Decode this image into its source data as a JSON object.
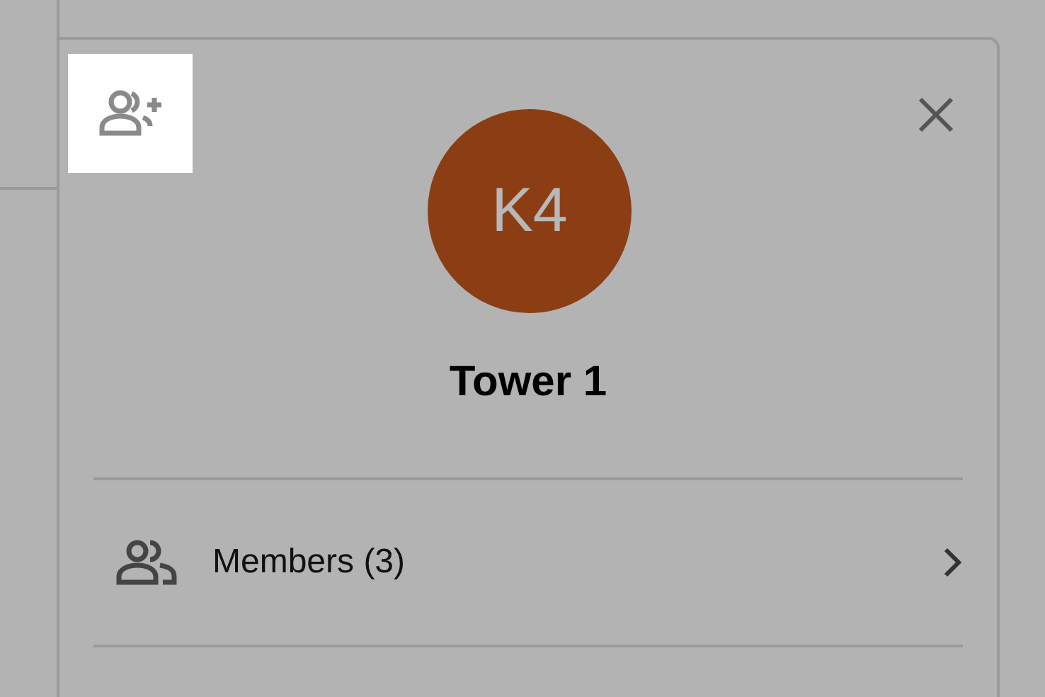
{
  "group": {
    "avatar_initials": "K4",
    "name": "Tower 1"
  },
  "menu": [
    {
      "label": "Members (3)"
    }
  ]
}
